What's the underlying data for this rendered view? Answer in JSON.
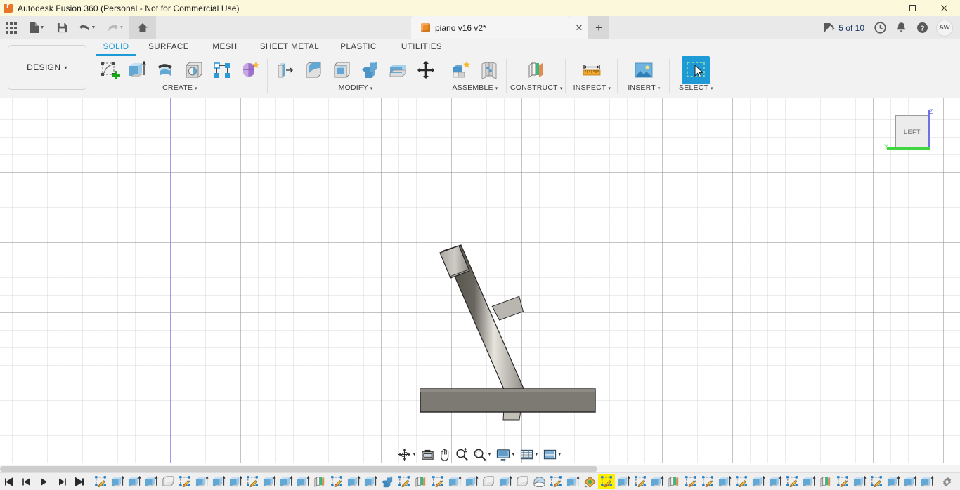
{
  "window": {
    "title": "Autodesk Fusion 360 (Personal - Not for Commercial Use)",
    "logo_text": "F",
    "minimize_label": "–",
    "maximize_label": "❐",
    "close_label": "✕"
  },
  "quick_access": {
    "items": [
      {
        "name": "app-grid-icon",
        "label": ""
      },
      {
        "name": "new-file-icon",
        "label": ""
      },
      {
        "name": "save-icon",
        "label": ""
      },
      {
        "name": "undo-icon",
        "label": ""
      },
      {
        "name": "redo-icon",
        "label": ""
      },
      {
        "name": "home-icon",
        "label": ""
      }
    ]
  },
  "document_tab": {
    "name": "piano v16 v2*",
    "close_label": "✕",
    "new_tab_label": "+"
  },
  "status_right": {
    "job_count": "5 of 10",
    "avatar_initials": "AW"
  },
  "ribbon": {
    "design_label": "DESIGN",
    "design_caret": "▾",
    "workspace_tabs": [
      {
        "label": "SOLID",
        "active": true
      },
      {
        "label": "SURFACE",
        "active": false
      },
      {
        "label": "MESH",
        "active": false
      },
      {
        "label": "SHEET METAL",
        "active": false
      },
      {
        "label": "PLASTIC",
        "active": false
      },
      {
        "label": "UTILITIES",
        "active": false
      }
    ],
    "panels": [
      {
        "label": "CREATE",
        "caret": "▾",
        "icons": [
          "create-sketch-icon",
          "extrude-icon",
          "revolve-icon",
          "hole-icon",
          "rib-pattern-icon",
          "form-icon"
        ]
      },
      {
        "label": "MODIFY",
        "caret": "▾",
        "icons": [
          "press-pull-icon",
          "fillet-icon",
          "shell-icon",
          "combine-icon",
          "split-face-icon",
          "move-copy-icon"
        ]
      },
      {
        "label": "ASSEMBLE",
        "caret": "▾",
        "icons": [
          "new-component-icon",
          "joint-icon"
        ]
      },
      {
        "label": "CONSTRUCT",
        "caret": "▾",
        "icons": [
          "offset-plane-icon"
        ]
      },
      {
        "label": "INSPECT",
        "caret": "▾",
        "icons": [
          "measure-icon"
        ]
      },
      {
        "label": "INSERT",
        "caret": "▾",
        "icons": [
          "insert-image-icon"
        ]
      },
      {
        "label": "SELECT",
        "caret": "▾",
        "icons": [
          "select-window-icon"
        ],
        "selected": true
      }
    ]
  },
  "viewcube": {
    "face_label": "LEFT",
    "axis_z_label": "Z",
    "axis_y_label": "Y",
    "axis_z_color": "#6f6fe8",
    "axis_y_color": "#3fd63f"
  },
  "canvas": {
    "background_color": "#ffffff",
    "grid_minor_spacing": 25,
    "grid_major_spacing": 100,
    "z_axis_color": "#9a9aee",
    "model_description": "Angled bar body crossing a horizontal flat bar, shaded grey metal"
  },
  "navigation_bar": {
    "items": [
      {
        "name": "orbit-icon",
        "caret": "▾"
      },
      {
        "name": "look-at-icon",
        "caret": ""
      },
      {
        "name": "pan-icon",
        "caret": ""
      },
      {
        "name": "zoom-icon",
        "caret": ""
      },
      {
        "name": "fit-icon",
        "caret": "▾"
      },
      {
        "name": "display-settings-icon",
        "caret": "▾"
      },
      {
        "name": "grid-snaps-icon",
        "caret": "▾"
      },
      {
        "name": "viewports-icon",
        "caret": "▾"
      }
    ]
  },
  "timeline": {
    "playback": [
      "skip-to-start-icon",
      "step-back-icon",
      "play-icon",
      "step-forward-icon",
      "skip-to-end-icon"
    ],
    "settings_icon": "timeline-settings-icon",
    "current_index": 30,
    "features": [
      {
        "type": "sketch"
      },
      {
        "type": "extrude"
      },
      {
        "type": "extrude"
      },
      {
        "type": "extrude"
      },
      {
        "type": "fillet"
      },
      {
        "type": "sketch"
      },
      {
        "type": "extrude"
      },
      {
        "type": "extrude"
      },
      {
        "type": "extrude"
      },
      {
        "type": "sketch"
      },
      {
        "type": "extrude"
      },
      {
        "type": "extrude"
      },
      {
        "type": "extrude"
      },
      {
        "type": "plane"
      },
      {
        "type": "sketch"
      },
      {
        "type": "extrude"
      },
      {
        "type": "extrude"
      },
      {
        "type": "combine"
      },
      {
        "type": "sketch"
      },
      {
        "type": "plane"
      },
      {
        "type": "sketch"
      },
      {
        "type": "extrude"
      },
      {
        "type": "extrude"
      },
      {
        "type": "fillet"
      },
      {
        "type": "extrude"
      },
      {
        "type": "fillet"
      },
      {
        "type": "revolve"
      },
      {
        "type": "sketch"
      },
      {
        "type": "extrude"
      },
      {
        "type": "appearance"
      },
      {
        "type": "sketch"
      },
      {
        "type": "extrude"
      },
      {
        "type": "sketch"
      },
      {
        "type": "extrude"
      },
      {
        "type": "plane"
      },
      {
        "type": "sketch"
      },
      {
        "type": "sketch"
      },
      {
        "type": "extrude"
      },
      {
        "type": "sketch"
      },
      {
        "type": "extrude"
      },
      {
        "type": "extrude"
      },
      {
        "type": "sketch"
      },
      {
        "type": "extrude"
      },
      {
        "type": "plane"
      },
      {
        "type": "sketch"
      },
      {
        "type": "extrude"
      },
      {
        "type": "sketch"
      },
      {
        "type": "extrude"
      },
      {
        "type": "extrude"
      },
      {
        "type": "extrude"
      }
    ]
  }
}
